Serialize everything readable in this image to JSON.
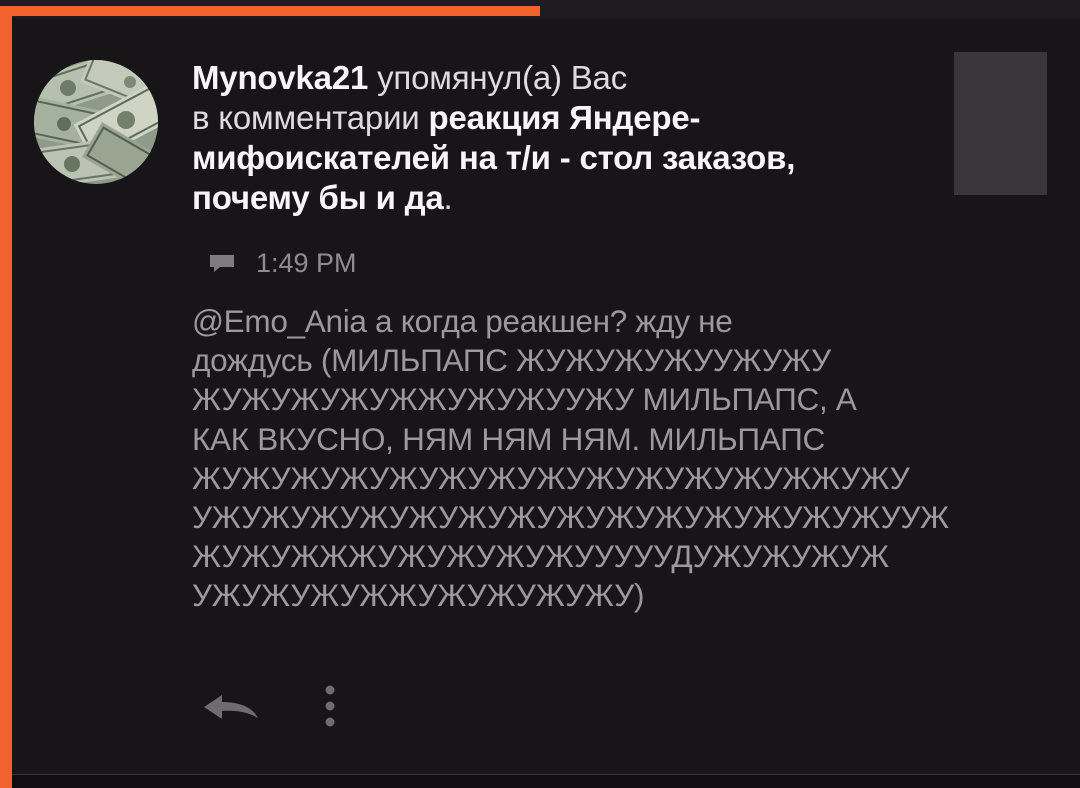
{
  "notification": {
    "username": "Mynovka21",
    "action_text": "упомянул(а) Вас",
    "context_text": "в комментарии",
    "post_title": "реакция Яндере-мифоискателей на т/и - стол заказов, почему бы и да",
    "trailing_punct": ".",
    "time": "1:49 PM",
    "comment": "@Emo_Ania а когда реакшен? жду не\nдождусь (МИЛЬПАПС ЖУЖУЖУЖУУЖУЖУ\nЖУЖУЖУЖУЖЖУЖУЖУУЖУ МИЛЬПАПС, А\nКАК ВКУСНО, НЯМ НЯМ НЯМ. МИЛЬПАПС\nЖУЖУЖУЖУЖУЖУЖУЖУЖУЖУЖУЖУЖЖУЖУ\nУЖУЖУЖУЖУЖУЖУЖУЖУЖУЖУЖУЖУЖУЖУУЖ\nЖУЖУЖЖЖУЖУЖУЖУЖУУУУУДУЖУЖУЖУЖ\nУЖУЖУЖУЖЖУЖУЖУЖУЖУ)",
    "avatar_icon": "money-avatar",
    "comment_icon": "comment-icon",
    "reply_icon": "reply-icon",
    "more_icon": "more-vertical-icon"
  },
  "colors": {
    "accent": "#f2622d",
    "background": "#171517",
    "thumbnail": "#3a373a"
  }
}
